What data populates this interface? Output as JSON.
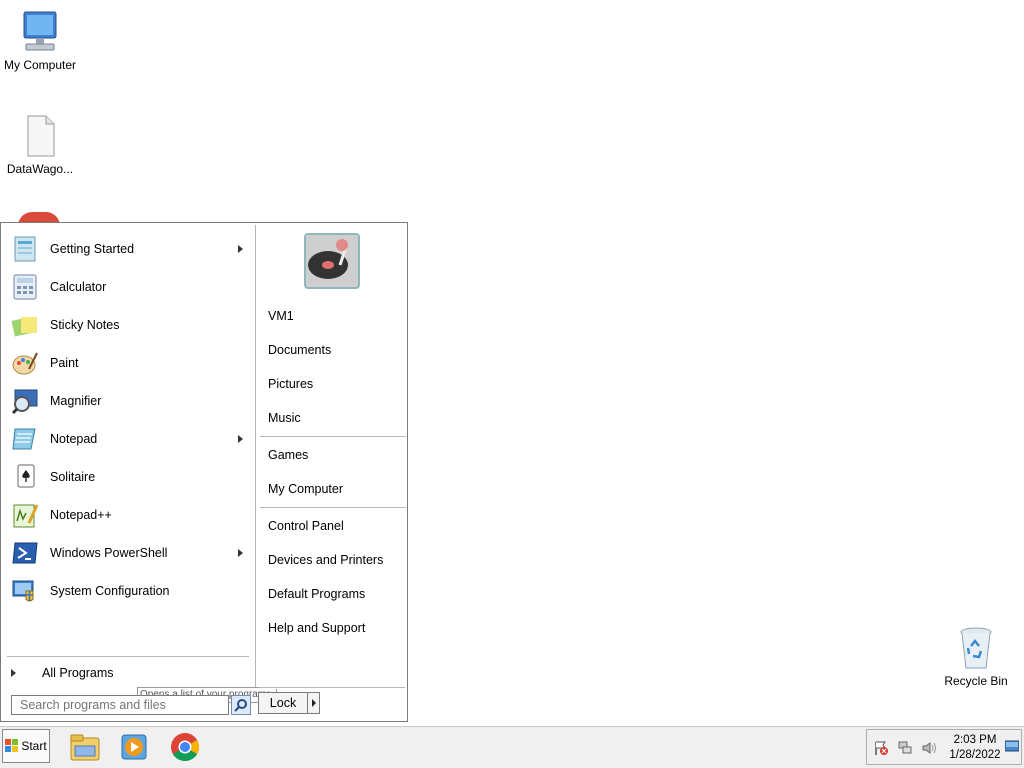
{
  "desktop": {
    "icons": [
      {
        "label": "My Computer",
        "icon": "computer-icon"
      },
      {
        "label": "DataWago...",
        "icon": "document-icon"
      },
      {
        "label": "Recycle Bin",
        "icon": "recycle-bin-icon"
      }
    ]
  },
  "start_menu": {
    "programs": [
      {
        "label": "Getting Started",
        "icon": "getting-started-icon",
        "has_submenu": true
      },
      {
        "label": "Calculator",
        "icon": "calculator-icon",
        "has_submenu": false
      },
      {
        "label": "Sticky Notes",
        "icon": "sticky-notes-icon",
        "has_submenu": false
      },
      {
        "label": "Paint",
        "icon": "paint-icon",
        "has_submenu": false
      },
      {
        "label": "Magnifier",
        "icon": "magnifier-icon",
        "has_submenu": false
      },
      {
        "label": "Notepad",
        "icon": "notepad-icon",
        "has_submenu": true
      },
      {
        "label": "Solitaire",
        "icon": "solitaire-icon",
        "has_submenu": false
      },
      {
        "label": "Notepad++",
        "icon": "notepadpp-icon",
        "has_submenu": false
      },
      {
        "label": "Windows PowerShell",
        "icon": "powershell-icon",
        "has_submenu": true
      },
      {
        "label": "System Configuration",
        "icon": "system-configuration-icon",
        "has_submenu": false
      }
    ],
    "all_programs_label": "All Programs",
    "search_placeholder": "Search programs and files",
    "tooltip": "Opens a list of your programs.",
    "right_items": [
      {
        "label": "VM1"
      },
      {
        "label": "Documents"
      },
      {
        "label": "Pictures"
      },
      {
        "label": "Music"
      },
      {
        "label": "Games"
      },
      {
        "label": "My Computer"
      },
      {
        "label": "Control Panel"
      },
      {
        "label": "Devices and Printers"
      },
      {
        "label": "Default Programs"
      },
      {
        "label": "Help and Support"
      }
    ],
    "lock_label": "Lock"
  },
  "taskbar": {
    "start_label": "Start",
    "apps": [
      {
        "name": "file-explorer-icon"
      },
      {
        "name": "media-player-icon"
      },
      {
        "name": "chrome-icon"
      }
    ],
    "clock_time": "2:03 PM",
    "clock_date": "1/28/2022"
  },
  "colors": {
    "accent": "#3a74c4",
    "taskbar_bg": "#f0f0f0"
  }
}
